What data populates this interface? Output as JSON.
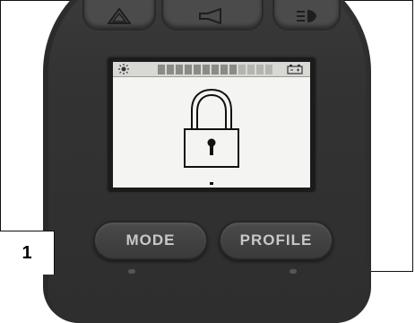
{
  "figure": {
    "number": "1"
  },
  "top_buttons": [
    {
      "icon": "hazard-triangle-icon"
    },
    {
      "icon": "horn-icon"
    },
    {
      "icon": "headlight-icon"
    }
  ],
  "display": {
    "status_icons": {
      "left": "light-icon",
      "right": "battery-icon"
    },
    "bar_segments_total": 13,
    "bar_segments_dark": 9,
    "center_icon": "padlock-icon"
  },
  "buttons": {
    "mode": "MODE",
    "profile": "PROFILE"
  }
}
